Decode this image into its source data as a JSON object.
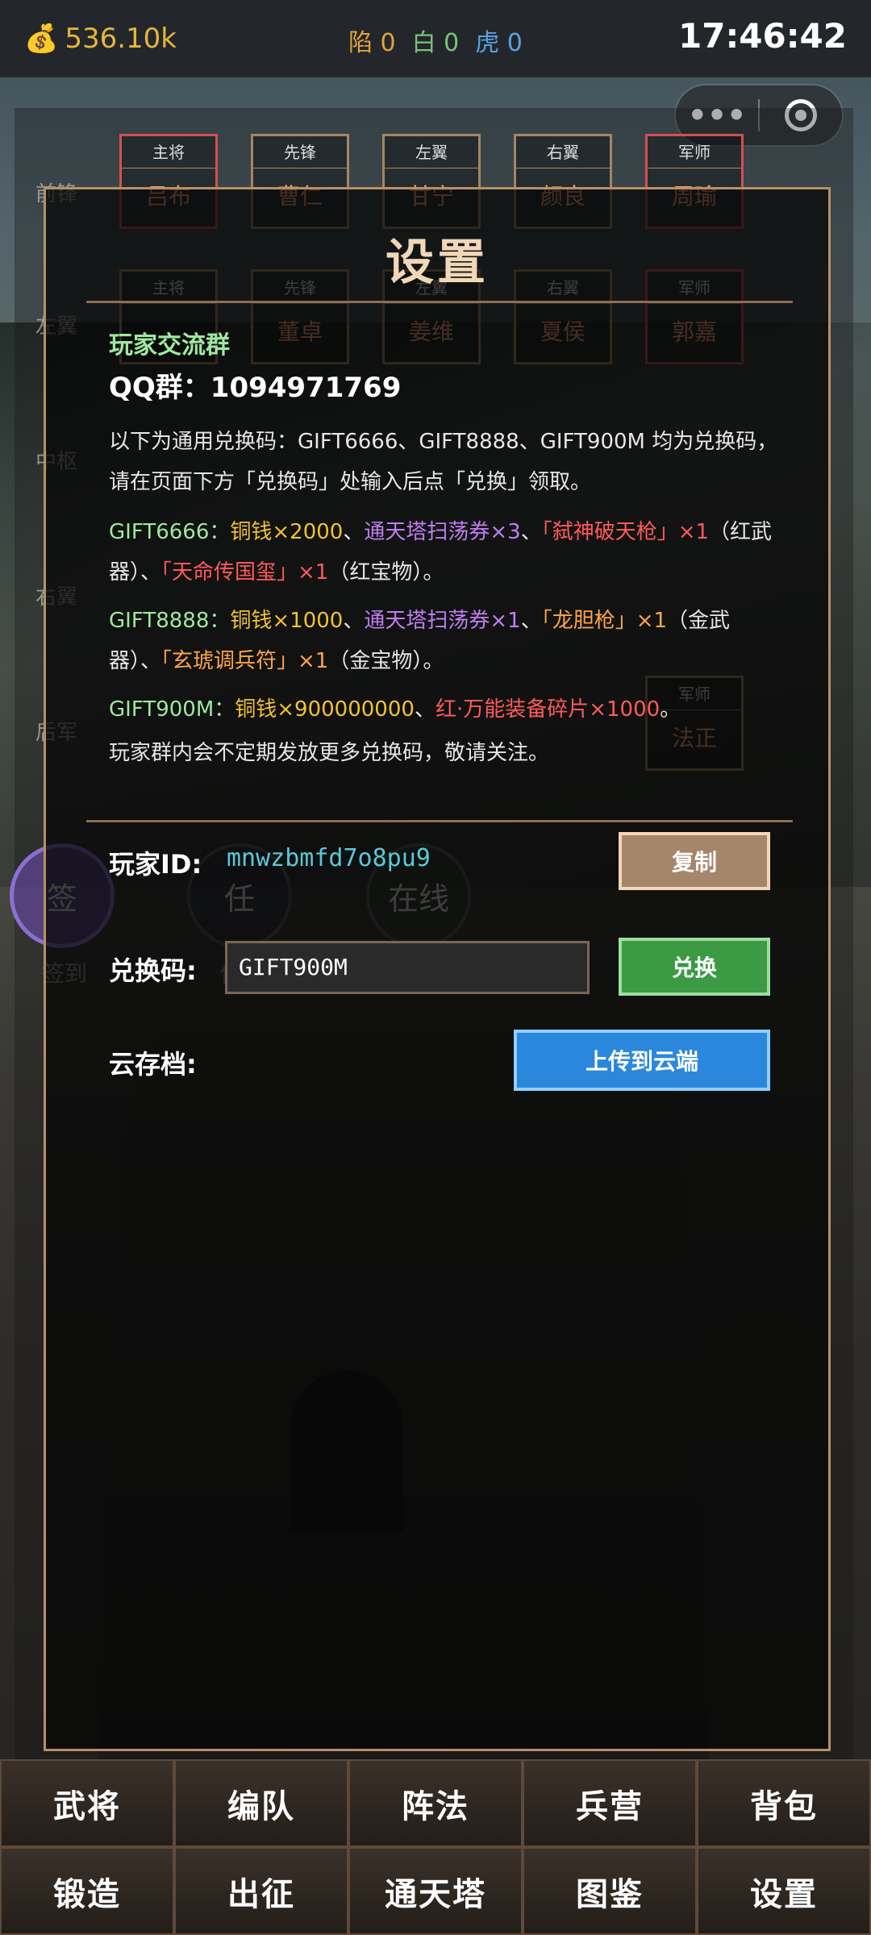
{
  "status": {
    "coin_icon": "money-bag-icon",
    "coins": "536.10k",
    "counters": [
      {
        "label": "陷 0"
      },
      {
        "label": "白 0"
      },
      {
        "label": "虎 0"
      }
    ],
    "time": "17:46:42"
  },
  "capsule": {
    "more_icon": "more-dots-icon",
    "close_icon": "target-circle-icon"
  },
  "formation": {
    "rows": [
      "前锋",
      "左翼",
      "中枢",
      "右翼",
      "后军"
    ],
    "slots_row1": [
      {
        "pos": "主将",
        "name": "吕布"
      },
      {
        "pos": "先锋",
        "name": "曹仁"
      },
      {
        "pos": "左翼",
        "name": "甘宁"
      },
      {
        "pos": "右翼",
        "name": "颜良"
      },
      {
        "pos": "军师",
        "name": "周瑜"
      }
    ],
    "slots_row2": [
      {
        "pos": "主将",
        "name": ""
      },
      {
        "pos": "先锋",
        "name": "董卓"
      },
      {
        "pos": "左翼",
        "name": "姜维"
      },
      {
        "pos": "右翼",
        "name": "夏侯"
      },
      {
        "pos": "军师",
        "name": "郭嘉"
      }
    ],
    "slots_row5": [
      {
        "pos": "军师",
        "name": "法正"
      }
    ],
    "left_buttons": [
      {
        "circle": "签",
        "label": "签到"
      },
      {
        "circle": "任",
        "label": "任务"
      },
      {
        "circle": "在线",
        "label": "在线"
      }
    ]
  },
  "modal": {
    "title": "设置",
    "group_title": "玩家交流群",
    "qq": "QQ群：1094971769",
    "intro": "以下为通用兑换码：GIFT6666、GIFT8888、GIFT900M 均为兑换码，请在页面下方「兑换码」处输入后点「兑换」领取。",
    "gift1": {
      "code": "GIFT6666：",
      "coin": "铜钱×2000",
      "sep1": "、",
      "ticket": "通天塔扫荡券×3",
      "sep2": "、",
      "weapon": "「弑神破天枪」×1",
      "note1": "（红武器）、",
      "treasure": "「天命传国玺」×1",
      "note2": "（红宝物）。"
    },
    "gift2": {
      "code": "GIFT8888：",
      "coin": "铜钱×1000",
      "sep1": "、",
      "ticket": "通天塔扫荡券×1",
      "sep2": "、",
      "weapon": "「龙胆枪」×1",
      "note1": "（金武器）、",
      "treasure": "「玄琥调兵符」×1",
      "note2": "（金宝物）。"
    },
    "gift3": {
      "code": "GIFT900M：",
      "coin": "铜钱×900000000",
      "sep1": "、",
      "shards": "红·万能装备碎片×1000",
      "end": "。"
    },
    "outro": "玩家群内会不定期发放更多兑换码，敬请关注。",
    "player_id_label": "玩家ID:",
    "player_id": "mnwzbmfd7o8pu9",
    "copy_label": "复制",
    "code_label": "兑换码:",
    "code_value": "GIFT900M",
    "redeem_label": "兑换",
    "cloud_label": "云存档:",
    "upload_label": "上传到云端"
  },
  "nav": [
    "武将",
    "编队",
    "阵法",
    "兵营",
    "背包",
    "锻造",
    "出征",
    "通天塔",
    "图鉴",
    "设置"
  ]
}
